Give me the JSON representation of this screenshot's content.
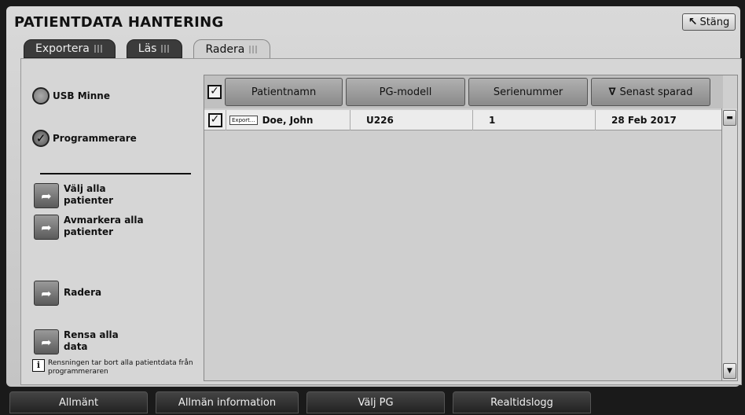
{
  "window": {
    "title": "PATIENTDATA HANTERING",
    "close_label": "Stäng"
  },
  "tabs": [
    {
      "label": "Exportera",
      "active": false
    },
    {
      "label": "Läs",
      "active": false
    },
    {
      "label": "Radera",
      "active": true
    }
  ],
  "source_options": [
    {
      "label": "USB Minne",
      "selected": false
    },
    {
      "label": "Programmerare",
      "selected": true
    }
  ],
  "actions": {
    "select_all": "Välj alla patienter",
    "deselect_all": "Avmarkera alla patienter",
    "delete": "Radera",
    "clear_all": "Rensa alla data"
  },
  "info_note": "Rensningen tar bort alla patientdata från programmeraren",
  "table": {
    "columns": [
      "Patientnamn",
      "PG-modell",
      "Serienummer",
      "Senast sparad"
    ],
    "sort_column": "Senast sparad",
    "rows": [
      {
        "checked": true,
        "tag": "Export...",
        "patient": "Doe, John",
        "model": "U226",
        "serial": "1",
        "saved": "28 Feb 2017"
      }
    ]
  },
  "bottom_nav": [
    "Allmänt",
    "Allmän information",
    "Välj PG",
    "Realtidslogg"
  ]
}
